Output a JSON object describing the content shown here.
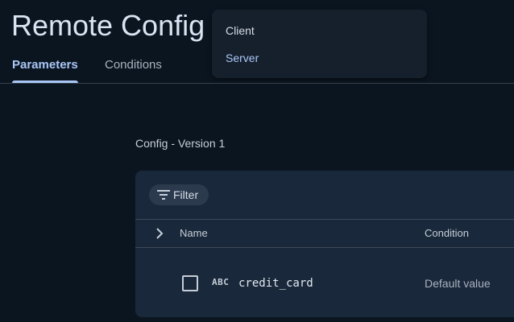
{
  "header": {
    "title": "Remote Config"
  },
  "tabs": [
    {
      "label": "Parameters",
      "active": true
    },
    {
      "label": "Conditions",
      "active": false
    }
  ],
  "dropdown": {
    "items": [
      {
        "label": "Client"
      },
      {
        "label": "Server",
        "selected": true
      }
    ]
  },
  "main": {
    "version_label": "Config - Version 1",
    "filter_label": "Filter",
    "columns": {
      "name": "Name",
      "condition": "Condition"
    },
    "rows": [
      {
        "type_badge": "ABC",
        "name": "credit_card",
        "condition": "Default value"
      }
    ]
  },
  "colors": {
    "background": "#0b1520",
    "card": "#19283a",
    "accent": "#a9c7f6"
  },
  "icons": {
    "filter": "filter-icon",
    "expand": "chevron-right-icon",
    "checkbox": "checkbox-icon"
  }
}
